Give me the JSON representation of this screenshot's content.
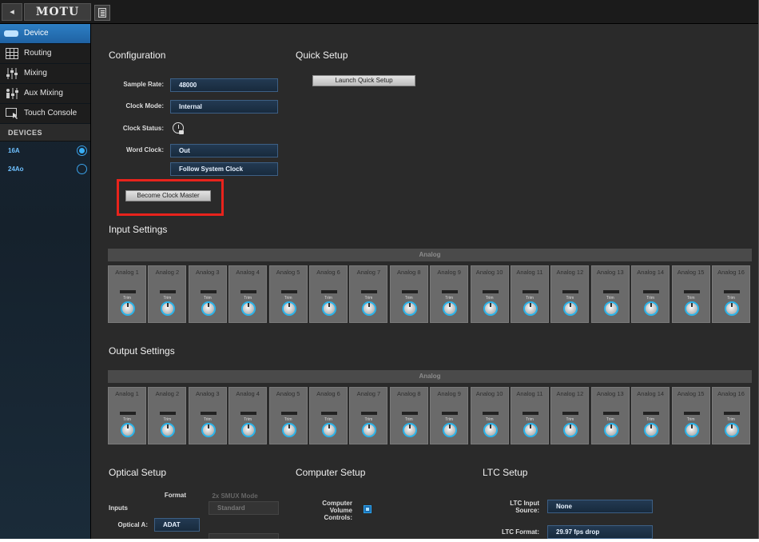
{
  "app": {
    "brand": "MOTU",
    "back_symbol": "◂"
  },
  "sidebar": {
    "items": [
      {
        "label": "Device"
      },
      {
        "label": "Routing"
      },
      {
        "label": "Mixing"
      },
      {
        "label": "Aux Mixing"
      },
      {
        "label": "Touch Console"
      }
    ],
    "devices_header": "DEVICES",
    "devices": [
      {
        "name": "16A",
        "selected": true
      },
      {
        "name": "24Ao",
        "selected": false
      }
    ]
  },
  "configuration": {
    "title": "Configuration",
    "sample_rate": {
      "label": "Sample Rate:",
      "value": "48000"
    },
    "clock_mode": {
      "label": "Clock Mode:",
      "value": "Internal"
    },
    "clock_status": {
      "label": "Clock Status:"
    },
    "word_clock": {
      "label": "Word Clock:",
      "value": "Out",
      "mode": "Follow System Clock"
    },
    "become_master_button": "Become Clock Master"
  },
  "quick_setup": {
    "title": "Quick Setup",
    "launch_button": "Launch Quick Setup"
  },
  "input_settings": {
    "title": "Input Settings",
    "bank": "Analog",
    "trim_label": "Trim",
    "channels": [
      "Analog 1",
      "Analog 2",
      "Analog 3",
      "Analog 4",
      "Analog 5",
      "Analog 6",
      "Analog 7",
      "Analog 8",
      "Analog 9",
      "Analog 10",
      "Analog 11",
      "Analog 12",
      "Analog 13",
      "Analog 14",
      "Analog 15",
      "Analog 16"
    ]
  },
  "output_settings": {
    "title": "Output Settings",
    "bank": "Analog",
    "trim_label": "Trim",
    "channels": [
      "Analog 1",
      "Analog 2",
      "Analog 3",
      "Analog 4",
      "Analog 5",
      "Analog 6",
      "Analog 7",
      "Analog 8",
      "Analog 9",
      "Analog 10",
      "Analog 11",
      "Analog 12",
      "Analog 13",
      "Analog 14",
      "Analog 15",
      "Analog 16"
    ]
  },
  "optical_setup": {
    "title": "Optical Setup",
    "format_header": "Format",
    "smux_header": "2x SMUX Mode",
    "inputs_label": "Inputs",
    "smux_value": "Standard",
    "optical_a": {
      "label": "Optical A:",
      "value": "ADAT"
    }
  },
  "computer_setup": {
    "title": "Computer Setup",
    "volume_label": "Computer Volume Controls:",
    "volume_checked": true
  },
  "ltc_setup": {
    "title": "LTC Setup",
    "input_source": {
      "label": "LTC Input Source:",
      "value": "None"
    },
    "format": {
      "label": "LTC Format:",
      "value": "29.97 fps drop"
    }
  }
}
